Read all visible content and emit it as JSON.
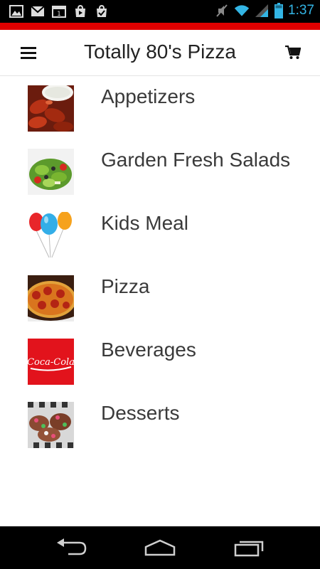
{
  "status_bar": {
    "time": "1:37",
    "icons": [
      "gallery-icon",
      "gmail-icon",
      "calendar-icon",
      "play-store-icon",
      "download-done-icon",
      "mute-icon",
      "wifi-icon",
      "signal-icon",
      "battery-icon"
    ]
  },
  "header": {
    "title": "Totally 80's Pizza",
    "accent_color": "#e00000"
  },
  "categories": [
    {
      "label": "Appetizers",
      "icon": "chicken-wings-image"
    },
    {
      "label": "Garden Fresh Salads",
      "icon": "salad-image"
    },
    {
      "label": "Kids Meal",
      "icon": "balloons-image"
    },
    {
      "label": "Pizza",
      "icon": "pizza-image"
    },
    {
      "label": "Beverages",
      "icon": "coca-cola-image"
    },
    {
      "label": "Desserts",
      "icon": "dessert-image"
    }
  ],
  "nav": {
    "buttons": [
      "back-icon",
      "home-icon",
      "recent-apps-icon"
    ]
  }
}
